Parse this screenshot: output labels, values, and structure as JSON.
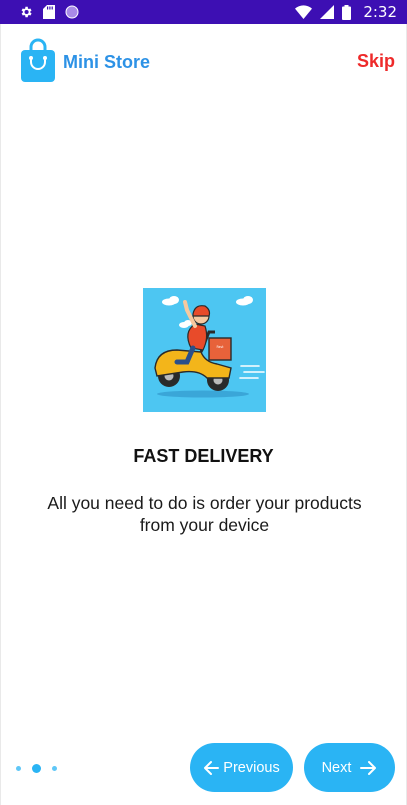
{
  "status_bar": {
    "time": "2:32",
    "icons": [
      "gear-icon",
      "sd-card-icon",
      "circle-notification-icon",
      "wifi-icon",
      "signal-icon",
      "battery-icon"
    ],
    "background": "#3d0fb3"
  },
  "header": {
    "app_name": "Mini Store",
    "skip_label": "Skip",
    "brand_color": "#2d92e6",
    "skip_color": "#ee2a2a",
    "logo_icon": "shopping-bag-icon"
  },
  "slide": {
    "illustration": "delivery-scooter-illustration",
    "title": "FAST DELIVERY",
    "description": "All you need to do is order your products from your device"
  },
  "pager": {
    "total_pages": 3,
    "current_page": 2
  },
  "buttons": {
    "previous_label": "Previous",
    "next_label": "Next",
    "accent": "#2ab4f4"
  }
}
